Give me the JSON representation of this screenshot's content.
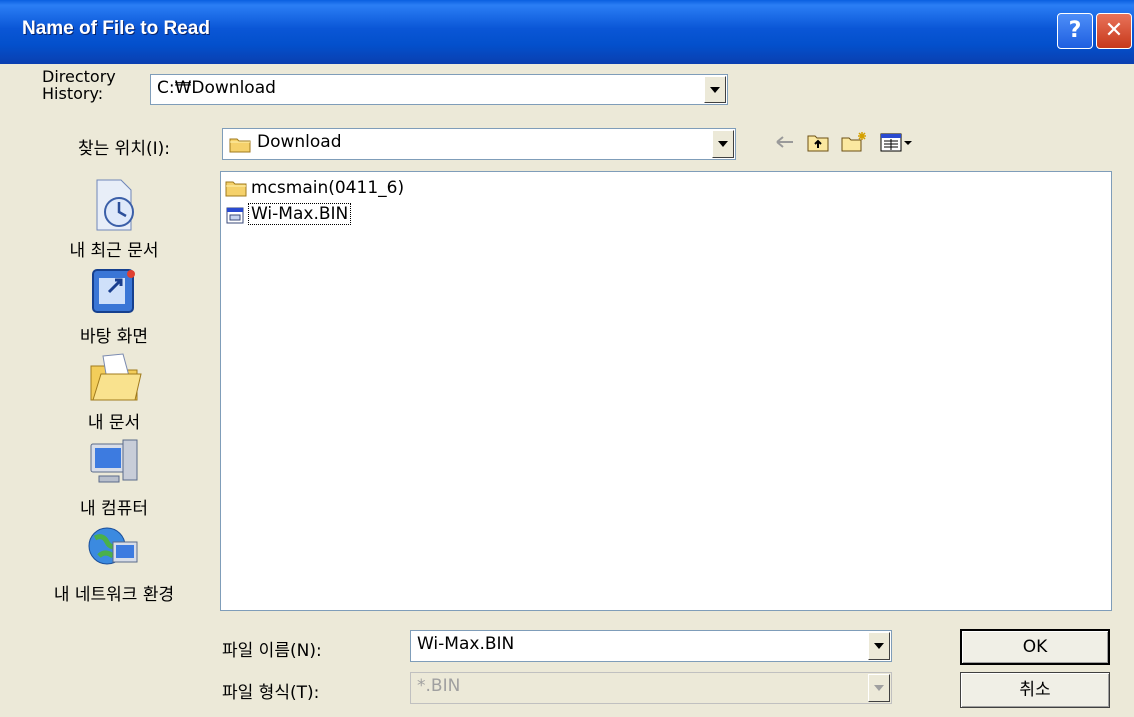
{
  "window": {
    "title": "Name of File to Read",
    "help_glyph": "?",
    "close_glyph": "✕"
  },
  "history": {
    "label_line1": "Directory",
    "label_line2": "History:",
    "value": "C:₩Download"
  },
  "lookin": {
    "label": "찾는 위치(I):",
    "value": "Download"
  },
  "toolbar": {
    "icons": [
      "back-icon",
      "up-folder-icon",
      "new-folder-icon",
      "view-menu-icon"
    ]
  },
  "places": [
    {
      "label": "내 최근 문서",
      "icon": "recent-documents-icon"
    },
    {
      "label": "바탕 화면",
      "icon": "desktop-icon"
    },
    {
      "label": "내 문서",
      "icon": "my-documents-icon"
    },
    {
      "label": "내 컴퓨터",
      "icon": "my-computer-icon"
    },
    {
      "label": "내 네트워크 환경",
      "icon": "network-icon"
    }
  ],
  "files": [
    {
      "name": "mcsmain(0411_6)",
      "icon": "folder-icon"
    },
    {
      "name": "Wi-Max.BIN",
      "icon": "bin-file-icon"
    }
  ],
  "filename": {
    "label": "파일 이름(N):",
    "value": "Wi-Max.BIN"
  },
  "filetype": {
    "label": "파일 형식(T):",
    "value": "*.BIN"
  },
  "buttons": {
    "ok": "OK",
    "cancel": "취소"
  },
  "colors": {
    "titlebar": "#0a56d6",
    "dialog_bg": "#ece9d8",
    "field_border": "#7f9db9"
  }
}
